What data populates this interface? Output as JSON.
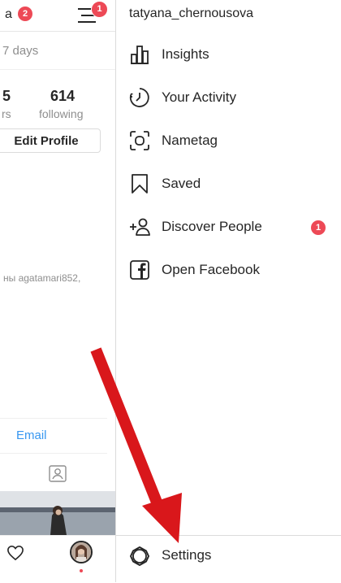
{
  "profile_panel": {
    "username_partial": "a",
    "username_badge": "2",
    "menu_badge": "1",
    "days_partial": "7 days",
    "stats": [
      {
        "value": "5",
        "label": "rs"
      },
      {
        "value": "614",
        "label": "following"
      }
    ],
    "edit_profile_label": "Edit Profile",
    "bio_partial": "ны agatamari852,",
    "email_label": "Email"
  },
  "drawer": {
    "username": "tatyana_chernousova",
    "items": [
      {
        "label": "Insights",
        "icon": "insights-icon"
      },
      {
        "label": "Your Activity",
        "icon": "activity-icon"
      },
      {
        "label": "Nametag",
        "icon": "nametag-icon"
      },
      {
        "label": "Saved",
        "icon": "bookmark-icon"
      },
      {
        "label": "Discover People",
        "icon": "add-person-icon",
        "badge": "1"
      },
      {
        "label": "Open Facebook",
        "icon": "facebook-icon"
      }
    ],
    "settings_label": "Settings"
  },
  "colors": {
    "badge": "#ed4956",
    "link": "#3897f0",
    "arrow": "#d9171b",
    "text": "#262626",
    "muted": "#8e8e8e"
  }
}
